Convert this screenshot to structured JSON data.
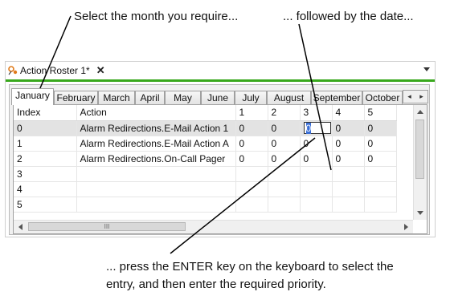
{
  "callouts": {
    "month": "Select the month you require...",
    "date": "... followed by the date...",
    "enter_line1": "... press the ENTER key on the keyboard to select the",
    "enter_line2": "entry, and then enter the required priority."
  },
  "window": {
    "doc_tab_title": "Action Roster 1*",
    "close_glyph": "✕",
    "accent_color": "#38a81c"
  },
  "months": [
    "January",
    "February",
    "March",
    "April",
    "May",
    "June",
    "July",
    "August",
    "September",
    "October"
  ],
  "active_month": "January",
  "tab_scroll": {
    "left": "◂",
    "right": "▸"
  },
  "grid": {
    "headers": {
      "index": "Index",
      "action": "Action",
      "d1": "1",
      "d2": "2",
      "d3": "3",
      "d4": "4",
      "d5": "5"
    },
    "rows": [
      {
        "index": "0",
        "action": "Alarm Redirections.E-Mail Action 1",
        "d1": "0",
        "d2": "0",
        "d3": "0",
        "d4": "0",
        "d5": "0"
      },
      {
        "index": "1",
        "action": "Alarm Redirections.E-Mail Action A",
        "d1": "0",
        "d2": "0",
        "d3": "0",
        "d4": "0",
        "d5": "0"
      },
      {
        "index": "2",
        "action": "Alarm Redirections.On-Call Pager",
        "d1": "0",
        "d2": "0",
        "d3": "0",
        "d4": "0",
        "d5": "0"
      },
      {
        "index": "3",
        "action": "",
        "d1": "",
        "d2": "",
        "d3": "",
        "d4": "",
        "d5": ""
      },
      {
        "index": "4",
        "action": "",
        "d1": "",
        "d2": "",
        "d3": "",
        "d4": "",
        "d5": ""
      },
      {
        "index": "5",
        "action": "",
        "d1": "",
        "d2": "",
        "d3": "",
        "d4": "",
        "d5": ""
      }
    ],
    "hscroll_grip": "III"
  }
}
